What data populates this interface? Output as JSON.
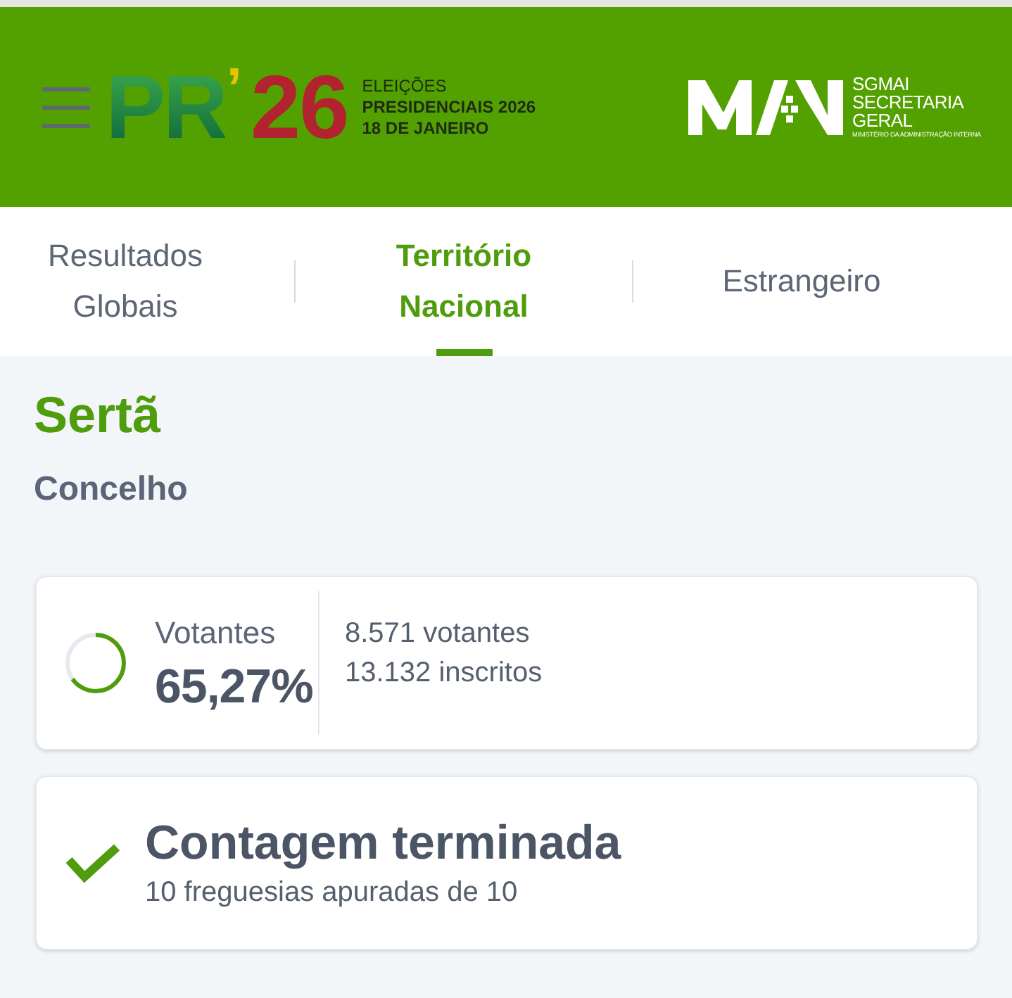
{
  "header": {
    "logo": {
      "letters": "PR",
      "apostrophe": "’",
      "year": "26",
      "caption": [
        "ELEIÇÕES",
        "PRESIDENCIAIS 2026",
        "18 DE JANEIRO"
      ]
    },
    "ministry": {
      "lines": [
        "SGMAI",
        "SECRETARIA",
        "GERAL"
      ],
      "subtitle": "MINISTÉRIO DA ADMINISTRAÇÃO INTERNA"
    }
  },
  "tabs": [
    {
      "label": "Resultados Globais",
      "selected": false
    },
    {
      "label": "Território Nacional",
      "selected": true
    },
    {
      "label": "Estrangeiro",
      "selected": false
    }
  ],
  "region": {
    "name": "Sertã",
    "type": "Concelho"
  },
  "turnout": {
    "label": "Votantes",
    "percent": "65,27%",
    "level": 0.6527,
    "voters": "8.571 votantes",
    "registered": "13.132 inscritos"
  },
  "count_status": {
    "complete": true,
    "title": "Contagem terminada",
    "detail": "10 freguesias apuradas de 10"
  }
}
